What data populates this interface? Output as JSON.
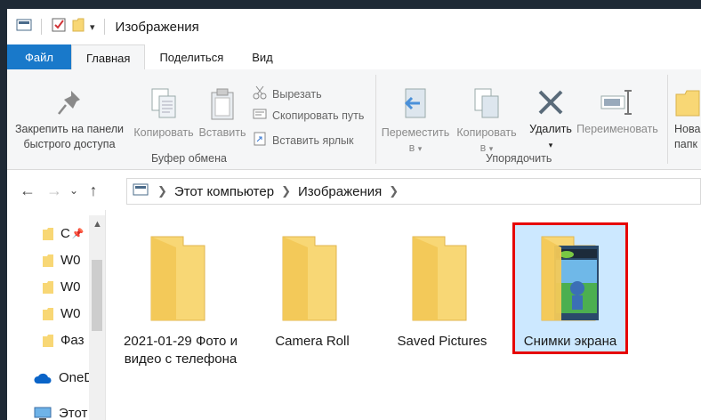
{
  "window": {
    "title": "Изображения"
  },
  "tabs": [
    {
      "label": "Файл"
    },
    {
      "label": "Главная"
    },
    {
      "label": "Поделиться"
    },
    {
      "label": "Вид"
    }
  ],
  "ribbon": {
    "pin": {
      "line1": "Закрепить на панели",
      "line2": "быстрого доступа"
    },
    "copy": "Копировать",
    "paste": "Вставить",
    "cut": "Вырезать",
    "copy_path": "Скопировать путь",
    "paste_shortcut": "Вставить ярлык",
    "group_clipboard": "Буфер обмена",
    "move_to": {
      "line1": "Переместить",
      "line2": "в"
    },
    "copy_to": {
      "line1": "Копировать",
      "line2": "в"
    },
    "delete": "Удалить",
    "rename": "Переименовать",
    "group_organize": "Упорядочить",
    "new_folder": {
      "line1": "Нова",
      "line2": "папк"
    }
  },
  "address": {
    "crumbs": [
      "Этот компьютер",
      "Изображения"
    ]
  },
  "sidebar": {
    "items": [
      {
        "label": "С"
      },
      {
        "label": "W0"
      },
      {
        "label": "W0"
      },
      {
        "label": "W0"
      },
      {
        "label": "Фаз"
      },
      {
        "label": "OneD"
      },
      {
        "label": "Этот"
      }
    ]
  },
  "content": {
    "items": [
      {
        "name": "2021-01-29 Фото и видео с телефона"
      },
      {
        "name": "Camera Roll"
      },
      {
        "name": "Saved Pictures"
      },
      {
        "name": "Снимки экрана"
      }
    ]
  },
  "colors": {
    "file_tab": "#1979ca",
    "folder": "#f8d775",
    "selection_border": "#e60000",
    "selection_fill": "#cce8ff"
  }
}
